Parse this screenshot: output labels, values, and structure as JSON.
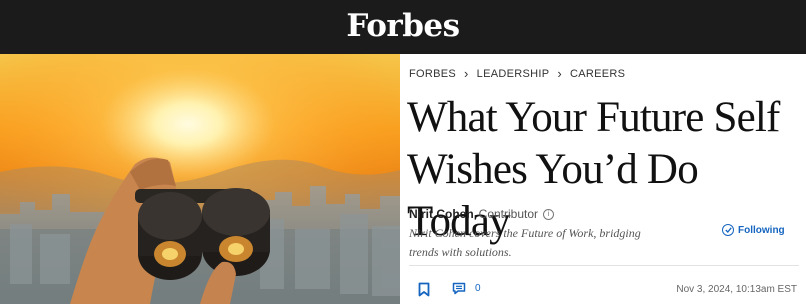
{
  "header": {
    "logo_text": "Forbes"
  },
  "breadcrumb": {
    "items": [
      "FORBES",
      "LEADERSHIP",
      "CAREERS"
    ],
    "separator": "›"
  },
  "article": {
    "headline_line1": "What Your Future Self",
    "headline_line2": "Wishes You’d Do Today",
    "author_name": "Nirit Cohen",
    "author_role": "Contributor",
    "author_bio_line1": "Nirit Cohen covers the Future of Work, bridging",
    "author_bio_line2": "trends with solutions.",
    "follow_label": "Following",
    "comment_count": "0",
    "date": "Nov 3, 2024, 10:13am EST"
  },
  "icons": {
    "info": "info-icon",
    "follow": "check-circle-icon",
    "bookmark": "bookmark-icon",
    "comments": "comment-icon"
  },
  "colors": {
    "topbar": "#1b1b1b",
    "accent": "#1565c0"
  }
}
